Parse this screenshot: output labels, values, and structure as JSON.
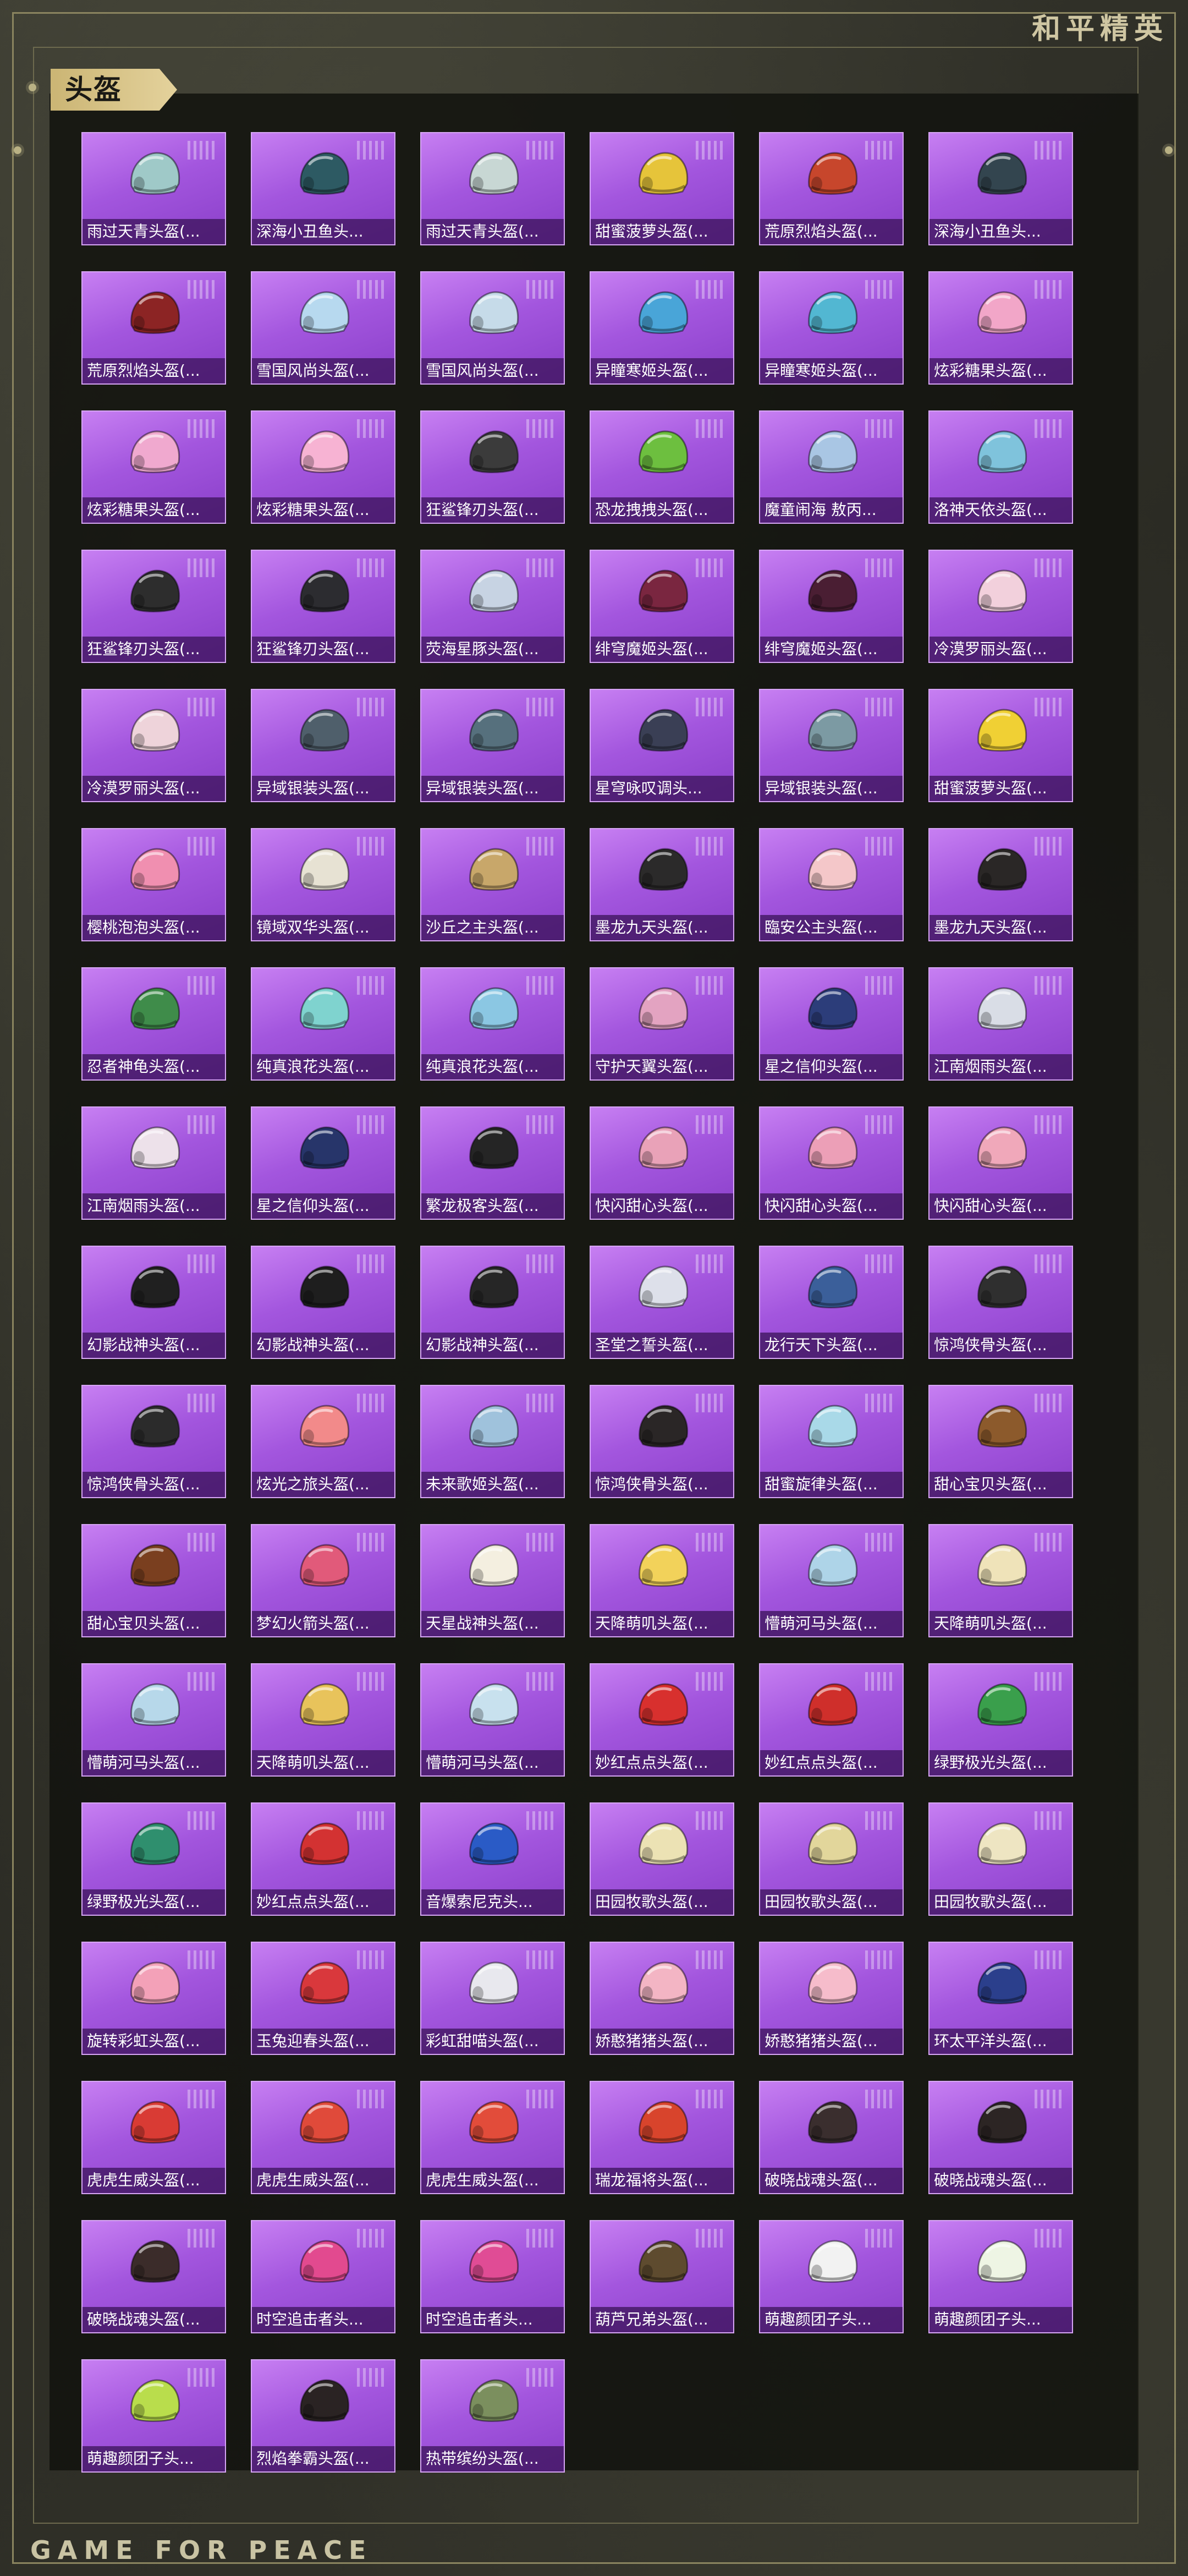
{
  "header": {
    "brand": "和平精英",
    "section_title": "头盔"
  },
  "footer": {
    "text": "GAME FOR PEACE"
  },
  "items": [
    {
      "label": "雨过天青头盔(...",
      "color": "#9fc9c8",
      "icon": "helmet-icon"
    },
    {
      "label": "深海小丑鱼头...",
      "color": "#2d5a63",
      "icon": "helmet-icon"
    },
    {
      "label": "雨过天青头盔(...",
      "color": "#c8d7d4",
      "icon": "helmet-icon"
    },
    {
      "label": "甜蜜菠萝头盔(...",
      "color": "#e6c43a",
      "icon": "helmet-icon"
    },
    {
      "label": "荒原烈焰头盔(...",
      "color": "#c7462c",
      "icon": "helmet-icon"
    },
    {
      "label": "深海小丑鱼头...",
      "color": "#33454f",
      "icon": "helmet-icon"
    },
    {
      "label": "荒原烈焰头盔(...",
      "color": "#8c2424",
      "icon": "helmet-icon"
    },
    {
      "label": "雪国风尚头盔(...",
      "color": "#b7d9ef",
      "icon": "helmet-icon"
    },
    {
      "label": "雪国风尚头盔(...",
      "color": "#c6dbe9",
      "icon": "helmet-icon"
    },
    {
      "label": "异瞳寒姬头盔(...",
      "color": "#49a5d8",
      "icon": "helmet-icon"
    },
    {
      "label": "异瞳寒姬头盔(...",
      "color": "#52b7d2",
      "icon": "helmet-icon"
    },
    {
      "label": "炫彩糖果头盔(...",
      "color": "#f2a6c8",
      "icon": "helmet-icon"
    },
    {
      "label": "炫彩糖果头盔(...",
      "color": "#f0a9cf",
      "icon": "helmet-icon"
    },
    {
      "label": "炫彩糖果头盔(...",
      "color": "#f7b3d3",
      "icon": "helmet-icon"
    },
    {
      "label": "狂鲨锋刃头盔(...",
      "color": "#3b3b3b",
      "icon": "helmet-icon"
    },
    {
      "label": "恐龙拽拽头盔(...",
      "color": "#6dbf3f",
      "icon": "helmet-icon"
    },
    {
      "label": "魔童闹海 敖丙...",
      "color": "#a9c6e4",
      "icon": "helmet-icon"
    },
    {
      "label": "洛神天依头盔(...",
      "color": "#7fc3dc",
      "icon": "helmet-icon"
    },
    {
      "label": "狂鲨锋刃头盔(...",
      "color": "#2d2d2d",
      "icon": "helmet-icon"
    },
    {
      "label": "狂鲨锋刃头盔(...",
      "color": "#2c2c30",
      "icon": "helmet-icon"
    },
    {
      "label": "荧海星豚头盔(...",
      "color": "#c7d3e3",
      "icon": "helmet-icon"
    },
    {
      "label": "绯穹魔姬头盔(...",
      "color": "#7a2640",
      "icon": "helmet-icon"
    },
    {
      "label": "绯穹魔姬头盔(...",
      "color": "#4a1e33",
      "icon": "helmet-icon"
    },
    {
      "label": "冷漠罗丽头盔(...",
      "color": "#f2d0dc",
      "icon": "helmet-icon"
    },
    {
      "label": "冷漠罗丽头盔(...",
      "color": "#eed3da",
      "icon": "helmet-icon"
    },
    {
      "label": "异域银装头盔(...",
      "color": "#4f5f6b",
      "icon": "helmet-icon"
    },
    {
      "label": "异域银装头盔(...",
      "color": "#56707d",
      "icon": "helmet-icon"
    },
    {
      "label": "星穹咏叹调头...",
      "color": "#3a3f55",
      "icon": "helmet-icon"
    },
    {
      "label": "异域银装头盔(...",
      "color": "#7c9aa3",
      "icon": "helmet-icon"
    },
    {
      "label": "甜蜜菠萝头盔(...",
      "color": "#f0d034",
      "icon": "helmet-icon"
    },
    {
      "label": "樱桃泡泡头盔(...",
      "color": "#f08fb0",
      "icon": "helmet-icon"
    },
    {
      "label": "镜域双华头盔(...",
      "color": "#e7e2d3",
      "icon": "helmet-icon"
    },
    {
      "label": "沙丘之主头盔(...",
      "color": "#c8a76a",
      "icon": "helmet-icon"
    },
    {
      "label": "墨龙九天头盔(...",
      "color": "#2b2a2a",
      "icon": "helmet-icon"
    },
    {
      "label": "臨安公主头盔(...",
      "color": "#f4c7c9",
      "icon": "helmet-icon"
    },
    {
      "label": "墨龙九天头盔(...",
      "color": "#2a2726",
      "icon": "helmet-icon"
    },
    {
      "label": "忍者神龟头盔(...",
      "color": "#3f8c4a",
      "icon": "helmet-icon"
    },
    {
      "label": "纯真浪花头盔(...",
      "color": "#7fd3cf",
      "icon": "helmet-icon"
    },
    {
      "label": "纯真浪花头盔(...",
      "color": "#8bc7e3",
      "icon": "helmet-icon"
    },
    {
      "label": "守护天翼头盔(...",
      "color": "#e3a3c1",
      "icon": "helmet-icon"
    },
    {
      "label": "星之信仰头盔(...",
      "color": "#2c3d7a",
      "icon": "helmet-icon"
    },
    {
      "label": "江南烟雨头盔(...",
      "color": "#d9dde6",
      "icon": "helmet-icon"
    },
    {
      "label": "江南烟雨头盔(...",
      "color": "#ede1ea",
      "icon": "helmet-icon"
    },
    {
      "label": "星之信仰头盔(...",
      "color": "#27356a",
      "icon": "helmet-icon"
    },
    {
      "label": "繁龙极客头盔(...",
      "color": "#252525",
      "icon": "helmet-icon"
    },
    {
      "label": "快闪甜心头盔(...",
      "color": "#e9a2b8",
      "icon": "helmet-icon"
    },
    {
      "label": "快闪甜心头盔(...",
      "color": "#ec9fb7",
      "icon": "helmet-icon"
    },
    {
      "label": "快闪甜心头盔(...",
      "color": "#f0a8ba",
      "icon": "helmet-icon"
    },
    {
      "label": "幻影战神头盔(...",
      "color": "#202020",
      "icon": "helmet-icon"
    },
    {
      "label": "幻影战神头盔(...",
      "color": "#1e1e1e",
      "icon": "helmet-icon"
    },
    {
      "label": "幻影战神头盔(...",
      "color": "#262626",
      "icon": "helmet-icon"
    },
    {
      "label": "圣堂之誓头盔(...",
      "color": "#dde0ea",
      "icon": "helmet-icon"
    },
    {
      "label": "龙行天下头盔(...",
      "color": "#3b5f9a",
      "icon": "helmet-icon"
    },
    {
      "label": "惊鸿侠骨头盔(...",
      "color": "#2f2f2f",
      "icon": "helmet-icon"
    },
    {
      "label": "惊鸿侠骨头盔(...",
      "color": "#2b2b2b",
      "icon": "helmet-icon"
    },
    {
      "label": "炫光之旅头盔(...",
      "color": "#f28a8a",
      "icon": "helmet-icon"
    },
    {
      "label": "未来歌姬头盔(...",
      "color": "#9fc2dc",
      "icon": "helmet-icon"
    },
    {
      "label": "惊鸿侠骨头盔(...",
      "color": "#2a2626",
      "icon": "helmet-icon"
    },
    {
      "label": "甜蜜旋律头盔(...",
      "color": "#a9d9e8",
      "icon": "helmet-icon"
    },
    {
      "label": "甜心宝贝头盔(...",
      "color": "#8c5a2c",
      "icon": "helmet-icon"
    },
    {
      "label": "甜心宝贝头盔(...",
      "color": "#7a3f1f",
      "icon": "helmet-icon"
    },
    {
      "label": "梦幻火箭头盔(...",
      "color": "#e15a7a",
      "icon": "helmet-icon"
    },
    {
      "label": "天星战神头盔(...",
      "color": "#f4efe0",
      "icon": "helmet-icon"
    },
    {
      "label": "天降萌叽头盔(...",
      "color": "#f2d25a",
      "icon": "helmet-icon"
    },
    {
      "label": "懵萌河马头盔(...",
      "color": "#aed4e8",
      "icon": "helmet-icon"
    },
    {
      "label": "天降萌叽头盔(...",
      "color": "#efe3b9",
      "icon": "helmet-icon"
    },
    {
      "label": "懵萌河马头盔(...",
      "color": "#b7d8ea",
      "icon": "helmet-icon"
    },
    {
      "label": "天降萌叽头盔(...",
      "color": "#e8c35b",
      "icon": "helmet-icon"
    },
    {
      "label": "懵萌河马头盔(...",
      "color": "#c8e1ee",
      "icon": "helmet-icon"
    },
    {
      "label": "妙红点点头盔(...",
      "color": "#d8302e",
      "icon": "helmet-icon"
    },
    {
      "label": "妙红点点头盔(...",
      "color": "#cf2f2b",
      "icon": "helmet-icon"
    },
    {
      "label": "绿野极光头盔(...",
      "color": "#3a9f4c",
      "icon": "helmet-icon"
    },
    {
      "label": "绿野极光头盔(...",
      "color": "#2f8f6e",
      "icon": "helmet-icon"
    },
    {
      "label": "妙红点点头盔(...",
      "color": "#d33232",
      "icon": "helmet-icon"
    },
    {
      "label": "音爆索尼克头...",
      "color": "#2a5bc6",
      "icon": "helmet-icon"
    },
    {
      "label": "田园牧歌头盔(...",
      "color": "#ece2b4",
      "icon": "helmet-icon"
    },
    {
      "label": "田园牧歌头盔(...",
      "color": "#e2d69b",
      "icon": "helmet-icon"
    },
    {
      "label": "田园牧歌头盔(...",
      "color": "#eee5c2",
      "icon": "helmet-icon"
    },
    {
      "label": "旋转彩虹头盔(...",
      "color": "#f3a1b8",
      "icon": "helmet-icon"
    },
    {
      "label": "玉兔迎春头盔(...",
      "color": "#d9383c",
      "icon": "helmet-icon"
    },
    {
      "label": "彩虹甜喵头盔(...",
      "color": "#e8e8ee",
      "icon": "helmet-icon"
    },
    {
      "label": "娇憨猪猪头盔(...",
      "color": "#f3b5c4",
      "icon": "helmet-icon"
    },
    {
      "label": "娇憨猪猪头盔(...",
      "color": "#f6bccb",
      "icon": "helmet-icon"
    },
    {
      "label": "环太平洋头盔(...",
      "color": "#2b3f8c",
      "icon": "helmet-icon"
    },
    {
      "label": "虎虎生威头盔(...",
      "color": "#d93b34",
      "icon": "helmet-icon"
    },
    {
      "label": "虎虎生威头盔(...",
      "color": "#e04a3a",
      "icon": "helmet-icon"
    },
    {
      "label": "虎虎生威头盔(...",
      "color": "#e24c3a",
      "icon": "helmet-icon"
    },
    {
      "label": "瑞龙福将头盔(...",
      "color": "#d8442c",
      "icon": "helmet-icon"
    },
    {
      "label": "破晓战魂头盔(...",
      "color": "#3a2e2e",
      "icon": "helmet-icon"
    },
    {
      "label": "破晓战魂头盔(...",
      "color": "#2c2524",
      "icon": "helmet-icon"
    },
    {
      "label": "破晓战魂头盔(...",
      "color": "#3b2c2a",
      "icon": "helmet-icon"
    },
    {
      "label": "时空追击者头...",
      "color": "#e24a8f",
      "icon": "helmet-icon"
    },
    {
      "label": "时空追击者头...",
      "color": "#e04c95",
      "icon": "helmet-icon"
    },
    {
      "label": "葫芦兄弟头盔(...",
      "color": "#5e4b2f",
      "icon": "helmet-icon"
    },
    {
      "label": "萌趣颜团子头...",
      "color": "#f2f2f2",
      "icon": "helmet-icon"
    },
    {
      "label": "萌趣颜团子头...",
      "color": "#eef5e4",
      "icon": "helmet-icon"
    },
    {
      "label": "萌趣颜团子头...",
      "color": "#b9dd4c",
      "icon": "helmet-icon"
    },
    {
      "label": "烈焰拳霸头盔(...",
      "color": "#2a2323",
      "icon": "helmet-icon"
    },
    {
      "label": "热带缤纷头盔(...",
      "color": "#7b8f5e",
      "icon": "helmet-icon"
    }
  ]
}
